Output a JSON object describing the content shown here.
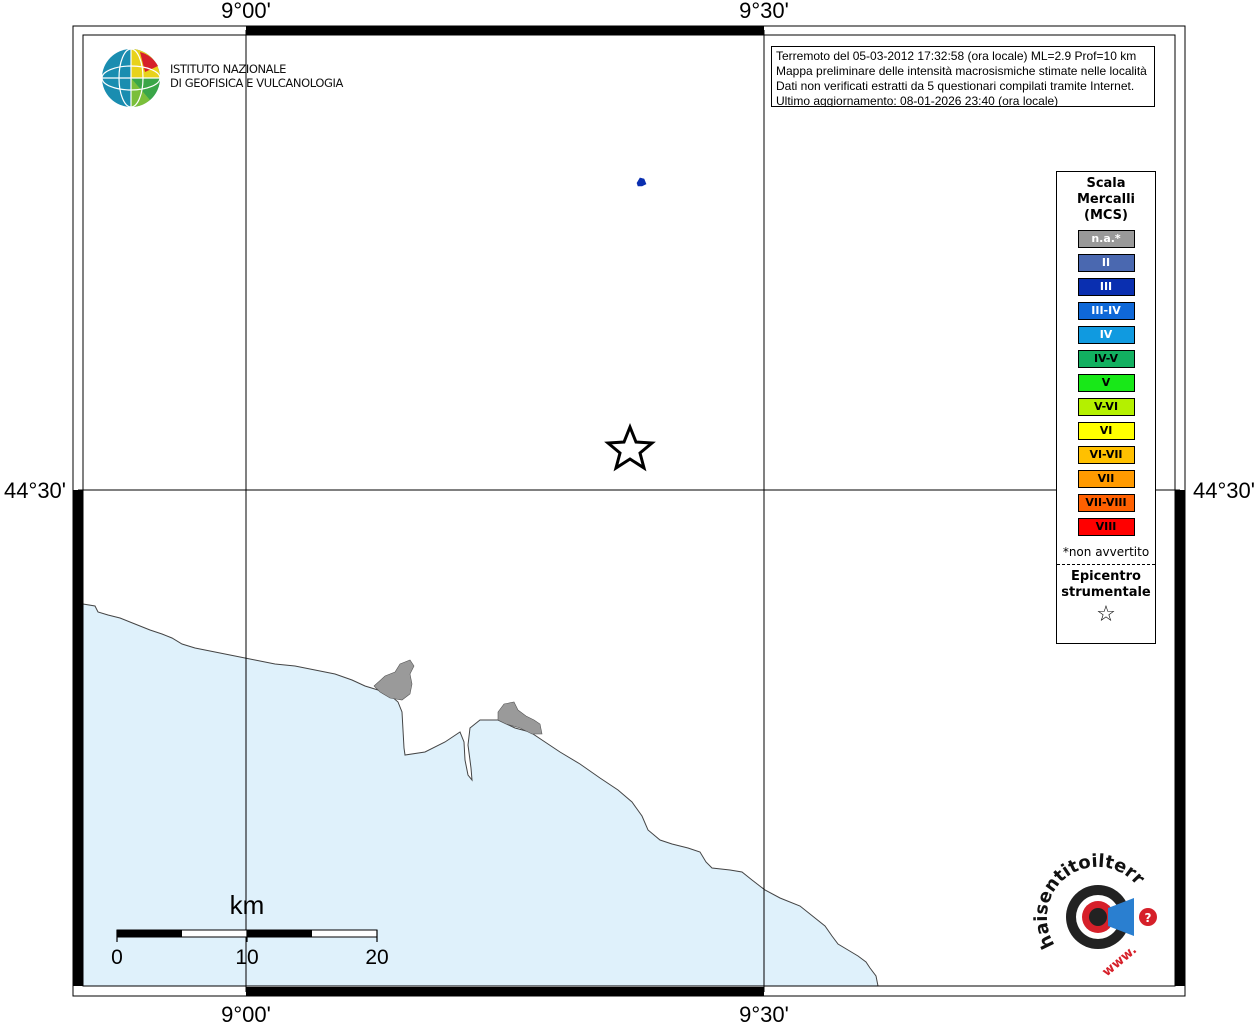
{
  "coordinates": {
    "top_left": "9°00'",
    "top_right": "9°30'",
    "bottom_left": "9°00'",
    "bottom_right": "9°30'",
    "left_lat": "44°30'",
    "right_lat": "44°30'"
  },
  "info": {
    "line1": "Terremoto del 05-03-2012 17:32:58 (ora locale) ML=2.9 Prof=10 km",
    "line2": "Mappa preliminare delle intensità macrosismiche stimate nelle località",
    "line3": "Dati non verificati estratti da 5 questionari compilati tramite Internet.",
    "line4": "Ultimo aggiornamento: 08-01-2026 23:40 (ora locale)"
  },
  "logo": {
    "line1": "ISTITUTO NAZIONALE",
    "line2": "DI GEOFISICA E VULCANOLOGIA"
  },
  "legend": {
    "title1": "Scala",
    "title2": "Mercalli",
    "title3": "(MCS)",
    "items": [
      {
        "label": "n.a.*",
        "color": "#999999",
        "text_color": "#ffffff"
      },
      {
        "label": "II",
        "color": "#4a68b0",
        "text_color": "#ffffff"
      },
      {
        "label": "III",
        "color": "#0a2fb0",
        "text_color": "#ffffff"
      },
      {
        "label": "III-IV",
        "color": "#0f68d8",
        "text_color": "#ffffff"
      },
      {
        "label": "IV",
        "color": "#109ae0",
        "text_color": "#ffffff"
      },
      {
        "label": "IV-V",
        "color": "#12b060",
        "text_color": "#000000"
      },
      {
        "label": "V",
        "color": "#18e818",
        "text_color": "#000000"
      },
      {
        "label": "V-VI",
        "color": "#b4f000",
        "text_color": "#000000"
      },
      {
        "label": "VI",
        "color": "#ffff00",
        "text_color": "#000000"
      },
      {
        "label": "VI-VII",
        "color": "#ffc000",
        "text_color": "#000000"
      },
      {
        "label": "VII",
        "color": "#ff9a00",
        "text_color": "#000000"
      },
      {
        "label": "VII-VIII",
        "color": "#ff6000",
        "text_color": "#000000"
      },
      {
        "label": "VIII",
        "color": "#ff0000",
        "text_color": "#000000"
      }
    ],
    "note": "*non avvertito",
    "epicentro1": "Epicentro",
    "epicentro2": "strumentale",
    "star_symbol": "☆"
  },
  "scale_bar": {
    "unit": "km",
    "label_0": "0",
    "label_10": "10",
    "label_20": "20"
  },
  "colors": {
    "sea": "#dff1fb",
    "urban": "#9a9a9a",
    "report_marker": "#0a2fb0"
  },
  "watermark": {
    "text_main": "haisentitoilterremoto.it",
    "text_sub": "www."
  }
}
